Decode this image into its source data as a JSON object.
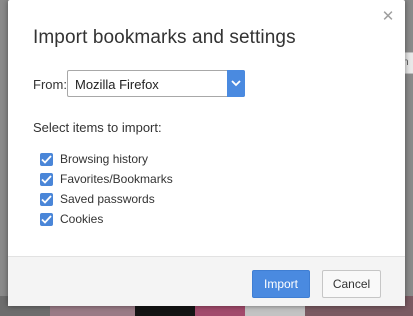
{
  "dialog": {
    "title": "Import bookmarks and settings",
    "close_icon": "close-icon"
  },
  "from": {
    "label": "From:",
    "selected": "Mozilla Firefox"
  },
  "items_label": "Select items to import:",
  "items": [
    {
      "label": "Browsing history",
      "checked": true
    },
    {
      "label": "Favorites/Bookmarks",
      "checked": true
    },
    {
      "label": "Saved passwords",
      "checked": true
    },
    {
      "label": "Cookies",
      "checked": true
    }
  ],
  "buttons": {
    "import_label": "Import",
    "cancel_label": "Cancel"
  },
  "colors": {
    "accent": "#4a8ae0",
    "checkbox": "#4a86d8"
  }
}
